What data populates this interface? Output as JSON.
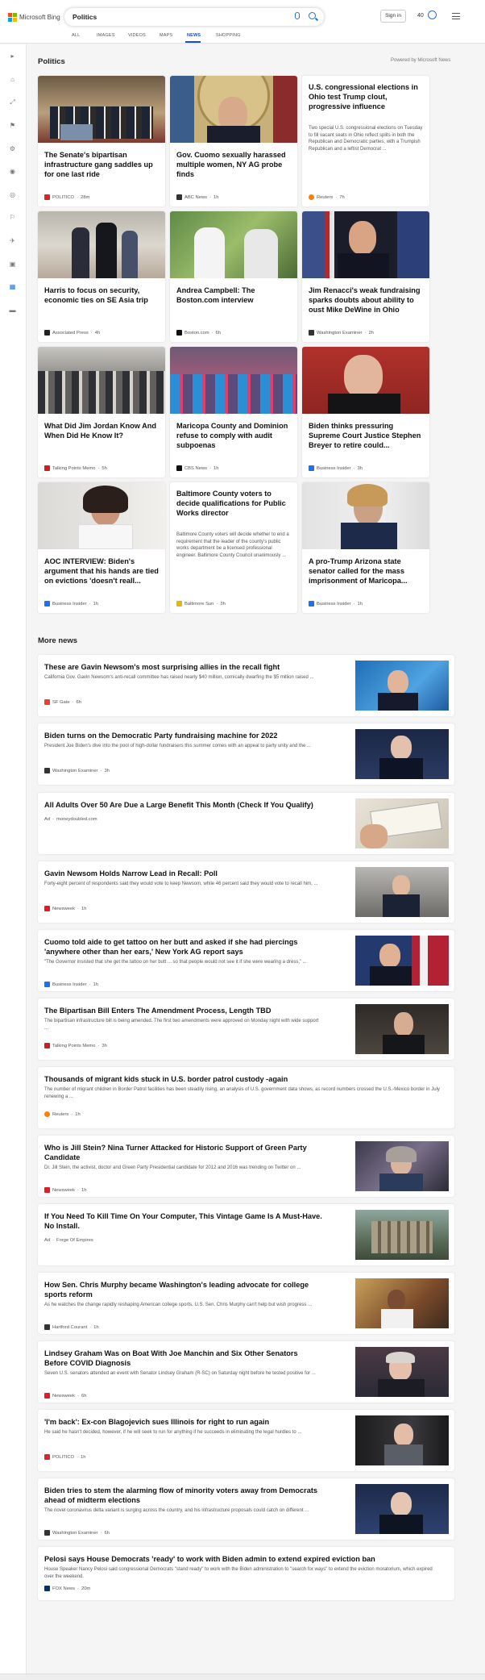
{
  "header": {
    "logo_text": "Microsoft Bing",
    "search_value": "Politics",
    "signin_label": "Sign in",
    "points": "40"
  },
  "tabs": [
    "ALL",
    "IMAGES",
    "VIDEOS",
    "MAPS",
    "NEWS",
    "SHOPPING"
  ],
  "active_tab": "NEWS",
  "page": {
    "section_title": "Politics",
    "powered_by": "Powered by Microsoft News",
    "more_news_title": "More news"
  },
  "cards": [
    {
      "title": "The Senate's bipartisan infrastructure gang saddles up for one last ride",
      "source": "POLITICO",
      "time": "28m",
      "snippet": ""
    },
    {
      "title": "Gov. Cuomo sexually harassed multiple women, NY AG probe finds",
      "source": "ABC News",
      "time": "1h",
      "snippet": ""
    },
    {
      "title": "U.S. congressional elections in Ohio test Trump clout, progressive influence",
      "source": "Reuters",
      "time": "7h",
      "snippet": "Two special U.S. congressional elections on Tuesday to fill vacant seats in Ohio reflect splits in both the Republican and Democratic parties, with a Trumpish Republican and a leftist Democrat ..."
    },
    {
      "title": "Harris to focus on security, economic ties on SE Asia trip",
      "source": "Associated Press",
      "time": "4h",
      "snippet": ""
    },
    {
      "title": "Andrea Campbell: The Boston.com interview",
      "source": "Boston.com",
      "time": "6h",
      "snippet": ""
    },
    {
      "title": "Jim Renacci's weak fundraising sparks doubts about ability to oust Mike DeWine in Ohio",
      "source": "Washington Examiner",
      "time": "2h",
      "snippet": ""
    },
    {
      "title": "What Did Jim Jordan Know And When Did He Know It?",
      "source": "Talking Points Memo",
      "time": "5h",
      "snippet": ""
    },
    {
      "title": "Maricopa County and Dominion refuse to comply with audit subpoenas",
      "source": "CBS News",
      "time": "1h",
      "snippet": ""
    },
    {
      "title": "Biden thinks pressuring Supreme Court Justice Stephen Breyer to retire could...",
      "source": "Business Insider",
      "time": "3h",
      "snippet": ""
    },
    {
      "title": "AOC INTERVIEW: Biden's argument that his hands are tied on evictions 'doesn't reall...",
      "source": "Business Insider",
      "time": "1h",
      "snippet": ""
    },
    {
      "title": "Baltimore County voters to decide qualifications for Public Works director",
      "source": "Baltimore Sun",
      "time": "3h",
      "snippet": "Baltimore County voters will decide whether to end a requirement that the leader of the county's public works department be a licensed professional engineer. Baltimore County Council unanimously ..."
    },
    {
      "title": "A pro-Trump Arizona state senator called for the mass imprisonment of Maricopa...",
      "source": "Business Insider",
      "time": "1h",
      "snippet": ""
    }
  ],
  "more_news": [
    {
      "title": "These are Gavin Newsom's most surprising allies in the recall fight",
      "snippet": "California Gov. Gavin Newsom's anti-recall committee has raised nearly $40 million, comically dwarfing the $5 million raised ...",
      "source": "SF Gate",
      "time": "6h",
      "ad": ""
    },
    {
      "title": "Biden turns on the Democratic Party fundraising machine for 2022",
      "snippet": "President Joe Biden's dive into the pool of high-dollar fundraisers this summer comes with an appeal to party unity and the ...",
      "source": "Washington Examiner",
      "time": "3h",
      "ad": ""
    },
    {
      "title": "All Adults Over 50 Are Due a Large Benefit This Month (Check If You Qualify)",
      "snippet": "",
      "source": "moneydoubled.com",
      "time": "",
      "ad": "Ad"
    },
    {
      "title": "Gavin Newsom Holds Narrow Lead in Recall: Poll",
      "snippet": "Forty-eight percent of respondents said they would vote to keep Newsom, while 46 percent said they would vote to recall him, ...",
      "source": "Newsweek",
      "time": "1h",
      "ad": ""
    },
    {
      "title": "Cuomo told aide to get tattoo on her butt and asked if she had piercings 'anywhere other than her ears,' New York AG report says",
      "snippet": "\"The Governor insisted that she get the tattoo on her butt ... so that people would not see it if she were wearing a dress,\" ...",
      "source": "Business Insider",
      "time": "1h",
      "ad": ""
    },
    {
      "title": "The Bipartisan Bill Enters The Amendment Process, Length TBD",
      "snippet": "The bipartisan infrastructure bill is being amended. The first two amendments were approved on Monday night with wide support ...",
      "source": "Talking Points Memo",
      "time": "3h",
      "ad": ""
    },
    {
      "title": "Thousands of migrant kids stuck in U.S. border patrol custody -again",
      "snippet": "The number of migrant children in Border Patrol facilities has been steadily rising, an analysis of U.S. government data shows, as record numbers crossed the U.S.-Mexico border in July renewing a ...",
      "source": "Reuters",
      "time": "1h",
      "ad": ""
    },
    {
      "title": "Who is Jill Stein? Nina Turner Attacked for Historic Support of Green Party Candidate",
      "snippet": "Dr. Jill Stein, the activist, doctor and Green Party Presidential candidate for 2012 and 2016 was trending on Twitter on ...",
      "source": "Newsweek",
      "time": "1h",
      "ad": ""
    },
    {
      "title": "If You Need To Kill Time On Your Computer, This Vintage Game Is A Must-Have. No Install.",
      "snippet": "",
      "source": "Forge Of Empires",
      "time": "",
      "ad": "Ad"
    },
    {
      "title": "How Sen. Chris Murphy became Washington's leading advocate for college sports reform",
      "snippet": "As he watches the change rapidly reshaping American college sports, U.S. Sen. Chris Murphy can't help but wish progress ...",
      "source": "Hartford Courant",
      "time": "1h",
      "ad": ""
    },
    {
      "title": "Lindsey Graham Was on Boat With Joe Manchin and Six Other Senators Before COVID Diagnosis",
      "snippet": "Seven U.S. senators attended an event with Senator Lindsey Graham (R-SC) on Saturday night before he tested positive for ...",
      "source": "Newsweek",
      "time": "6h",
      "ad": ""
    },
    {
      "title": "'I'm back': Ex-con Blagojevich sues Illinois for right to run again",
      "snippet": "He said he hasn't decided, however, if he will seek to run for anything if he succeeds in eliminating the legal hurdles to ...",
      "source": "POLITICO",
      "time": "1h",
      "ad": ""
    },
    {
      "title": "Biden tries to stem the alarming flow of minority voters away from Democrats ahead of midterm elections",
      "snippet": "The novel coronavirus delta variant is surging across the country, and his infrastructure proposals could catch on different ...",
      "source": "Washington Examiner",
      "time": "6h",
      "ad": ""
    },
    {
      "title": "Pelosi says House Democrats 'ready' to work with Biden admin to extend expired eviction ban",
      "snippet": "House Speaker Nancy Pelosi said congressional Democrats \"stand ready\" to work with the Biden administration to \"search for ways\" to extend the eviction moratorium, which expired over the weekend.",
      "source": "FOX News",
      "time": "20m",
      "ad": ""
    }
  ],
  "colors": {
    "accent": "#174ae4",
    "background": "#f5f5f5"
  }
}
